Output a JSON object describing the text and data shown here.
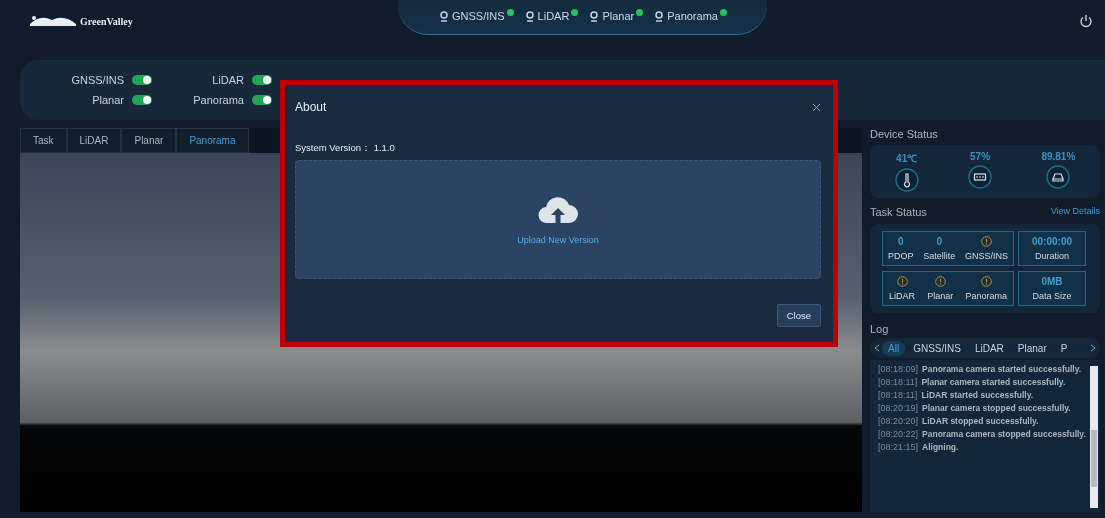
{
  "header": {
    "logo": "GreenValley",
    "sensors": [
      {
        "label": "GNSS/INS",
        "color": "#22c55e"
      },
      {
        "label": "LiDAR",
        "color": "#22c55e"
      },
      {
        "label": "Planar",
        "color": "#22c55e"
      },
      {
        "label": "Panorama",
        "color": "#22c55e"
      }
    ]
  },
  "switches": [
    {
      "label": "GNSS/INS",
      "on": true
    },
    {
      "label": "LiDAR",
      "on": true
    },
    {
      "label": "Planar",
      "on": true
    },
    {
      "label": "Panorama",
      "on": true
    }
  ],
  "view_tabs": [
    {
      "label": "Task",
      "selected": false
    },
    {
      "label": "LiDAR",
      "selected": false
    },
    {
      "label": "Planar",
      "selected": false
    },
    {
      "label": "Panorama",
      "selected": true
    }
  ],
  "device_status": {
    "title": "Device Status",
    "items": [
      {
        "value": "41℃",
        "kind": "temperature"
      },
      {
        "value": "57%",
        "kind": "memory"
      },
      {
        "value": "89.81%",
        "kind": "disk"
      }
    ]
  },
  "task_status": {
    "title": "Task Status",
    "link": "View Details",
    "rows": [
      {
        "tiles": [
          {
            "items": [
              {
                "kind": "value",
                "value": "0",
                "label": "PDOP"
              },
              {
                "kind": "value",
                "value": "0",
                "label": "Satellite"
              },
              {
                "kind": "warning",
                "label": "GNSS/INS"
              }
            ]
          },
          {
            "items": [
              {
                "kind": "value",
                "value": "00:00:00",
                "label": "Duration"
              }
            ]
          }
        ]
      },
      {
        "tiles": [
          {
            "items": [
              {
                "kind": "warning",
                "label": "LiDAR"
              },
              {
                "kind": "warning",
                "label": "Planar"
              },
              {
                "kind": "warning",
                "label": "Panorama"
              }
            ]
          },
          {
            "items": [
              {
                "kind": "value",
                "value": "0MB",
                "label": "Data Size"
              }
            ]
          }
        ]
      }
    ]
  },
  "log": {
    "title": "Log",
    "tabs": [
      {
        "label": "All",
        "selected": true
      },
      {
        "label": "GNSS/INS",
        "selected": false
      },
      {
        "label": "LiDAR",
        "selected": false
      },
      {
        "label": "Planar",
        "selected": false
      },
      {
        "label": "P",
        "selected": false
      }
    ],
    "entries": [
      {
        "time": "[08:18:09]",
        "message": "Panorama camera started successfully."
      },
      {
        "time": "[08:18:11]",
        "message": "Planar camera started successfully."
      },
      {
        "time": "[08:18:11]",
        "message": "LiDAR started successfully."
      },
      {
        "time": "[08:20:19]",
        "message": "Planar camera stopped successfully."
      },
      {
        "time": "[08:20:20]",
        "message": "LiDAR stopped successfully."
      },
      {
        "time": "[08:20:22]",
        "message": "Panorama camera stopped successfully."
      },
      {
        "time": "[08:21:15]",
        "message": "Aligning."
      }
    ]
  },
  "dialog": {
    "title": "About",
    "version_label": "System Version：",
    "version": "1.1.0",
    "upload": "Upload New Version",
    "close_button": "Close"
  }
}
